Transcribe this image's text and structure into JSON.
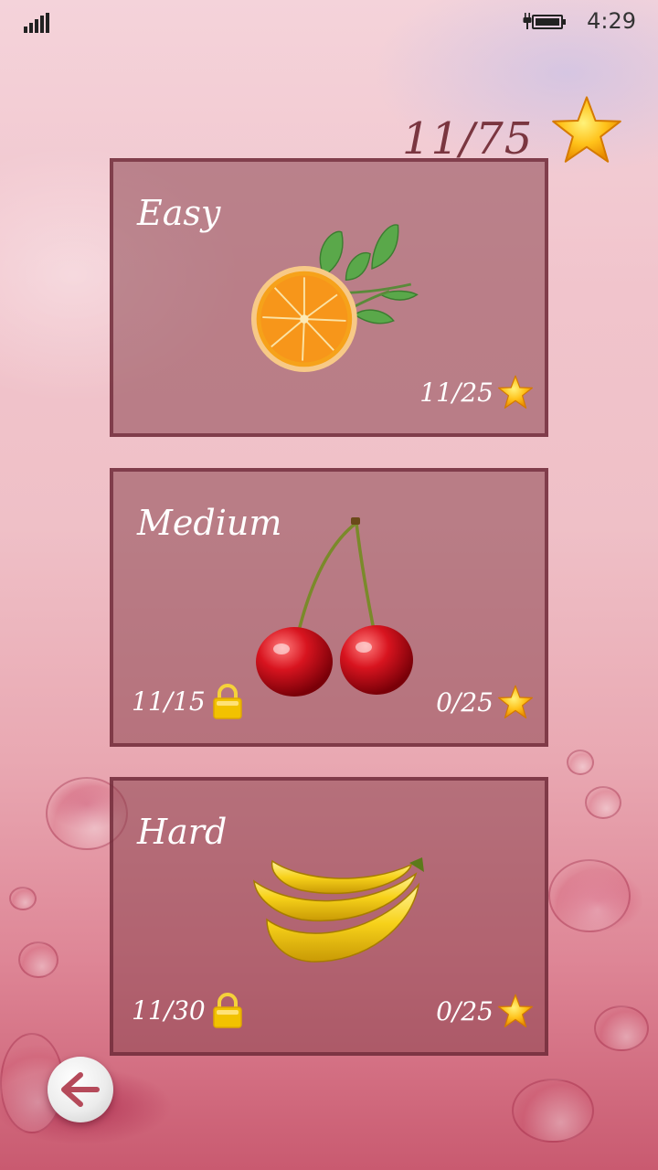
{
  "status_bar": {
    "signal_icon": "signal-strength-icon",
    "battery_icon": "battery-charging-icon",
    "time": "4:29"
  },
  "header": {
    "total_score": "11/75",
    "star_icon": "star-icon"
  },
  "levels": [
    {
      "title": "Easy",
      "fruit_icon": "orange-icon",
      "stars": "11/25",
      "locked": false
    },
    {
      "title": "Medium",
      "fruit_icon": "cherry-icon",
      "unlock_progress": "11/15",
      "stars": "0/25",
      "locked": true
    },
    {
      "title": "Hard",
      "fruit_icon": "banana-icon",
      "unlock_progress": "11/30",
      "stars": "0/25",
      "locked": true
    }
  ],
  "navigation": {
    "back_icon": "back-arrow-icon"
  },
  "colors": {
    "card_background": "#8c4650",
    "card_border": "#6e2837",
    "star": "#f7b500",
    "lock": "#f2c200",
    "score_text": "#7a3640"
  }
}
